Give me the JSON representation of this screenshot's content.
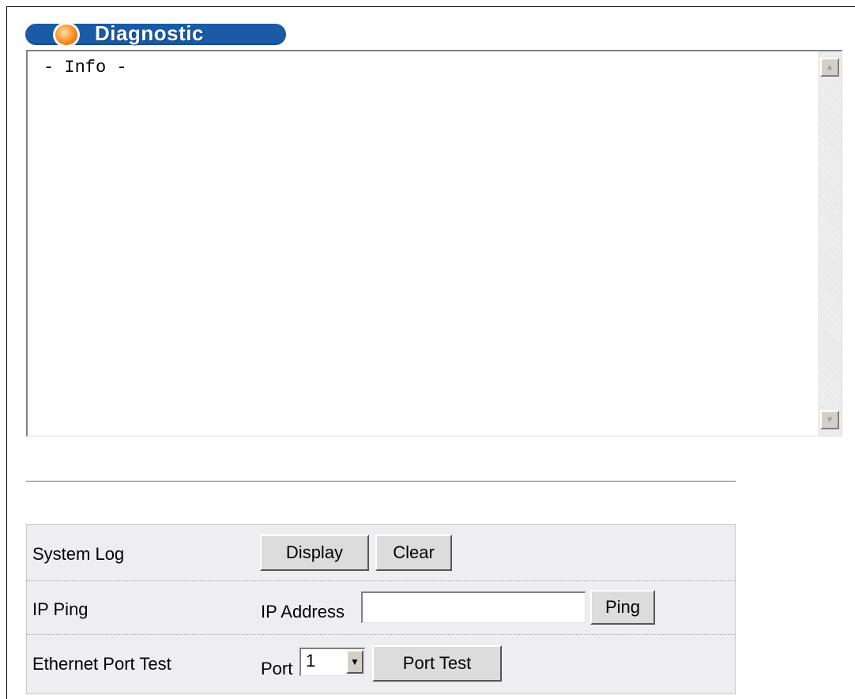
{
  "page": {
    "title": "Diagnostic"
  },
  "info_box": {
    "text": "- Info -"
  },
  "system_log": {
    "label": "System Log",
    "display_button": "Display",
    "clear_button": "Clear"
  },
  "ip_ping": {
    "label": "IP Ping",
    "field_label": "IP Address",
    "value": "",
    "ping_button": "Ping"
  },
  "port_test": {
    "label": "Ethernet Port Test",
    "port_label": "Port",
    "port_value": "1",
    "port_test_button": "Port Test"
  },
  "colors": {
    "title_bar": "#1a5aa6",
    "panel_bg": "#eeeef0",
    "button_bg": "#dcdcdc"
  }
}
